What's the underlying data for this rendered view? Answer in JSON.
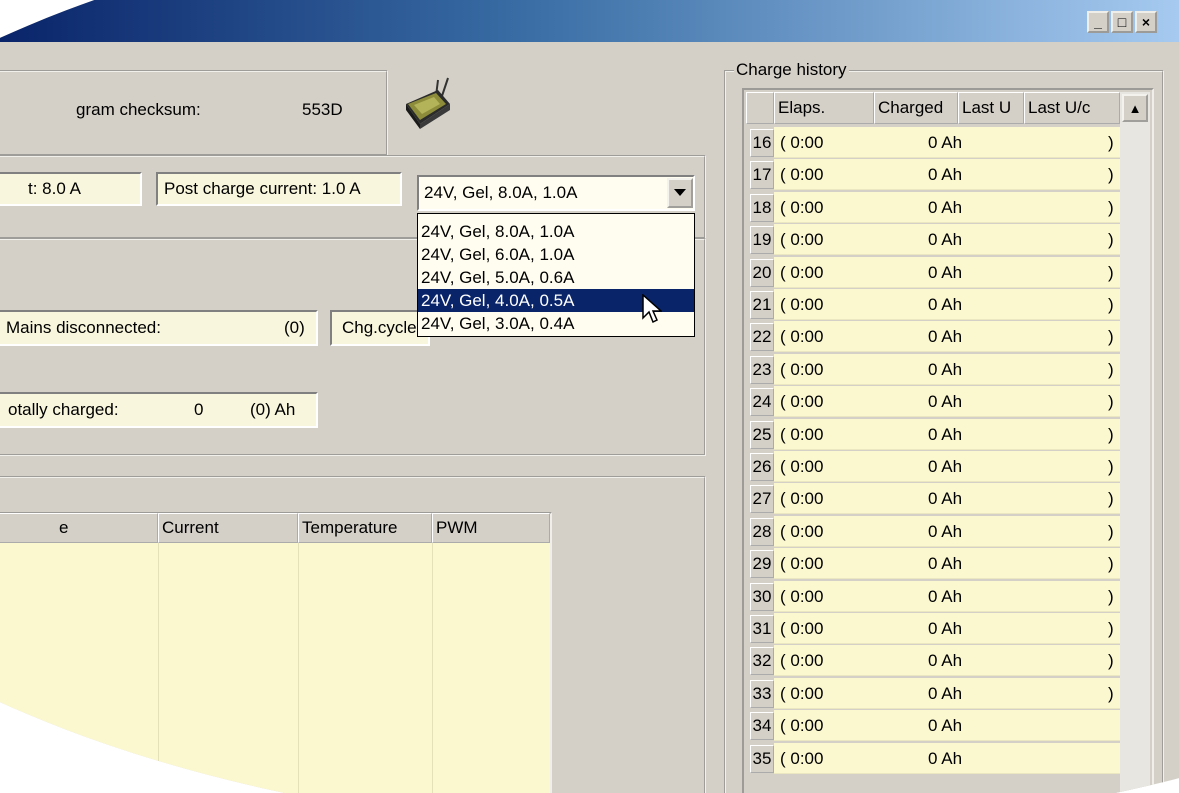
{
  "window": {
    "minimize_glyph": "_",
    "maximize_glyph": "□",
    "close_glyph": "×"
  },
  "info": {
    "checksum_label": "gram checksum:",
    "checksum_value": "553D",
    "device_icon": "charger-device-icon"
  },
  "settings": {
    "charge_current_partial": "t: 8.0 A",
    "post_charge_current": "Post charge current: 1.0 A",
    "profile_selected": "24V, Gel, 8.0A, 1.0A",
    "profile_options": [
      "24V, Gel, 8.0A, 1.0A",
      "24V, Gel, 6.0A, 1.0A",
      "24V, Gel, 5.0A, 0.6A",
      "24V, Gel, 4.0A, 0.5A",
      "24V, Gel, 3.0A, 0.4A"
    ],
    "highlighted_option_index": 3
  },
  "stats": {
    "mains_disconnected_label": "Mains disconnected:",
    "mains_disconnected_value": "(0)",
    "chg_cycles_label": "Chg.cycle",
    "totally_charged_label": "otally charged:",
    "totally_charged_value": "0",
    "totally_charged_paren": "(0) Ah"
  },
  "log_table": {
    "columns": [
      "e",
      "Current",
      "Temperature",
      "PWM"
    ]
  },
  "charge_history": {
    "title": "Charge history",
    "columns": [
      "Elaps.",
      "Charged",
      "Last U",
      "Last U/c"
    ],
    "scroll_up_glyph": "▲",
    "rows": [
      {
        "num": "16",
        "elapsed": "( 0:00",
        "charged": "0 Ah",
        "end": ")"
      },
      {
        "num": "17",
        "elapsed": "( 0:00",
        "charged": "0 Ah",
        "end": ")"
      },
      {
        "num": "18",
        "elapsed": "( 0:00",
        "charged": "0 Ah",
        "end": ")"
      },
      {
        "num": "19",
        "elapsed": "( 0:00",
        "charged": "0 Ah",
        "end": ")"
      },
      {
        "num": "20",
        "elapsed": "( 0:00",
        "charged": "0 Ah",
        "end": ")"
      },
      {
        "num": "21",
        "elapsed": "( 0:00",
        "charged": "0 Ah",
        "end": ")"
      },
      {
        "num": "22",
        "elapsed": "( 0:00",
        "charged": "0 Ah",
        "end": ")"
      },
      {
        "num": "23",
        "elapsed": "( 0:00",
        "charged": "0 Ah",
        "end": ")"
      },
      {
        "num": "24",
        "elapsed": "( 0:00",
        "charged": "0 Ah",
        "end": ")"
      },
      {
        "num": "25",
        "elapsed": "( 0:00",
        "charged": "0 Ah",
        "end": ")"
      },
      {
        "num": "26",
        "elapsed": "( 0:00",
        "charged": "0 Ah",
        "end": ")"
      },
      {
        "num": "27",
        "elapsed": "( 0:00",
        "charged": "0 Ah",
        "end": ")"
      },
      {
        "num": "28",
        "elapsed": "( 0:00",
        "charged": "0 Ah",
        "end": ")"
      },
      {
        "num": "29",
        "elapsed": "( 0:00",
        "charged": "0 Ah",
        "end": ")"
      },
      {
        "num": "30",
        "elapsed": "( 0:00",
        "charged": "0 Ah",
        "end": ")"
      },
      {
        "num": "31",
        "elapsed": "( 0:00",
        "charged": "0 Ah",
        "end": ")"
      },
      {
        "num": "32",
        "elapsed": "( 0:00",
        "charged": "0 Ah",
        "end": ")"
      },
      {
        "num": "33",
        "elapsed": "( 0:00",
        "charged": "0 Ah",
        "end": ")"
      },
      {
        "num": "34",
        "elapsed": "( 0:00",
        "charged": "0 Ah",
        "end": ""
      },
      {
        "num": "35",
        "elapsed": "( 0:00",
        "charged": "0 Ah",
        "end": ""
      }
    ]
  }
}
